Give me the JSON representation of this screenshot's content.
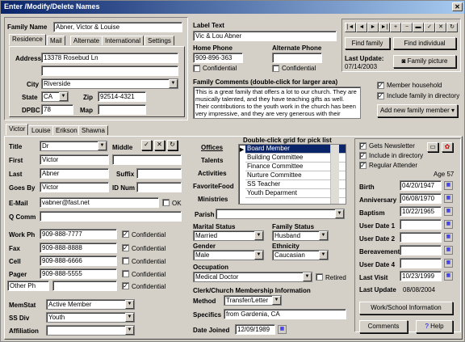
{
  "window": {
    "title": "Enter /Modify/Delete Names",
    "close": "✕"
  },
  "family": {
    "name_label": "Family Name",
    "name": "Abner, Victor & Louise",
    "tabs": [
      "Residence",
      "Mail",
      "Alternate",
      "International",
      "Settings"
    ],
    "address_label": "Address",
    "address1": "13378 Rosebud Ln",
    "address2": "",
    "city_label": "City",
    "city": "Riverside",
    "state_label": "State",
    "state": "CA",
    "zip_label": "Zip",
    "zip": "92514-4321",
    "dpbc_label": "DPBC",
    "dpbc": "78",
    "map_label": "Map",
    "map": ""
  },
  "label_text": {
    "label": "Label Text",
    "value": "Vic & Lou Abner"
  },
  "home_phone": {
    "label": "Home Phone",
    "value": "909-896-363",
    "confidential": "Confidential"
  },
  "alt_phone": {
    "label": "Alternate Phone",
    "value": "",
    "confidential": "Confidential"
  },
  "comments": {
    "label": "Family Comments  (double-click for larger area)",
    "text": "This is a great family that offers a lot to our church. They are musically talented, and they have teaching gifts as well. Their contributions to the youth work in the church has been very impressive, and they are very generous with their"
  },
  "nav_buttons": [
    "|◄",
    "◄",
    "►",
    "►|",
    "+",
    "−",
    "▬",
    "✓",
    "✕",
    "↻"
  ],
  "find_family": "Find family",
  "find_individual": "Find individual",
  "last_update_label": "Last Update:",
  "last_update": "07/14/2003",
  "family_picture": "Family picture",
  "member_household": "Member household",
  "include_directory": "Include family in directory",
  "add_member": "Add new family member ▾",
  "person_tabs": [
    "Victor",
    "Louise",
    "Erikson",
    "Shawna"
  ],
  "person": {
    "title_label": "Title",
    "title": "Dr",
    "middle_label": "Middle",
    "middle": "",
    "first_label": "First",
    "first": "Victor",
    "last_label": "Last",
    "last": "Abner",
    "suffix_label": "Suffix",
    "suffix": "",
    "goesby_label": "Goes By",
    "goesby": "Victor",
    "idnum_label": "ID Num",
    "idnum": "",
    "email_label": "E-Mail",
    "email": "vabner@fast.net",
    "ok": "OK",
    "qcomm_label": "Q Comm",
    "qcomm": "",
    "work_label": "Work Ph",
    "work": "909-888-7777",
    "fax_label": "Fax",
    "fax": "909-888-8888",
    "cell_label": "Cell",
    "cell": "909-888-6666",
    "pager_label": "Pager",
    "pager": "909-888-5555",
    "other_label": "Other Ph",
    "other": "",
    "confidential": "Confidential",
    "memstat_label": "MemStat",
    "memstat": "Active Member",
    "ssdiv_label": "SS Div",
    "ssdiv": "Youth",
    "affil_label": "Affiliation",
    "affil": ""
  },
  "mid": {
    "offices": "Offices",
    "grid_label": "Double-click grid for pick list",
    "talents": "Talents",
    "activities": "Activities",
    "favfood": "FavoriteFood",
    "ministries": "Ministries",
    "list": [
      "Board Member",
      "Building Committee",
      "Finance Committee",
      "Nurture Committee",
      "SS Teacher",
      "Youth Deparment"
    ],
    "parish_label": "Parish",
    "parish": "",
    "marital_label": "Marital Status",
    "marital": "Married",
    "famstat_label": "Family Status",
    "famstat": "Husband",
    "gender_label": "Gender",
    "gender": "Male",
    "ethnic_label": "Ethnicity",
    "ethnic": "Caucasian",
    "occ_label": "Occupation",
    "occ": "Medical Doctor",
    "retired": "Retired",
    "clerk_label": "Clerk/Church Membership Information",
    "method_label": "Method",
    "method": "Transfer/Letter",
    "spec_label": "Specifics",
    "spec": "from Gardenia, CA",
    "joined_label": "Date Joined",
    "joined": "12/09/1989"
  },
  "right": {
    "newsletter": "Gets Newsletter",
    "directory": "Include in directory",
    "regular": "Regular Attender",
    "age": "Age 57",
    "birth_label": "Birth",
    "birth": "04/20/1947",
    "anniv_label": "Anniversary",
    "anniv": "06/08/1970",
    "baptism_label": "Baptism",
    "baptism": "10/22/1965",
    "ud1_label": "User Date 1",
    "ud1": "",
    "ud2_label": "User Date 2",
    "ud2": "",
    "bereave_label": "Bereavement",
    "bereave": "",
    "ud4_label": "User Date 4",
    "ud4": "",
    "lastvisit_label": "Last Visit",
    "lastvisit": "10/23/1999",
    "lastupd_label": "Last Update",
    "lastupd": "08/08/2004",
    "work_school": "Work/School Information",
    "comments": "Comments",
    "help": "Help"
  }
}
